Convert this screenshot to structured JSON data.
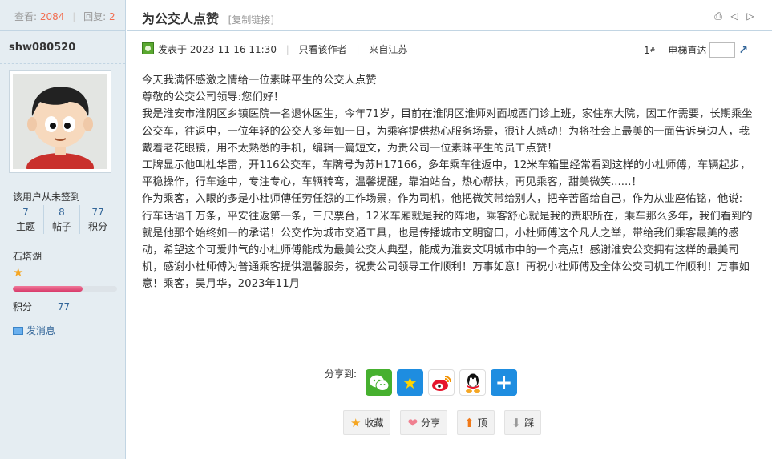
{
  "sidebar": {
    "views_label": "查看:",
    "views": "2084",
    "replies_label": "回复:",
    "replies": "2",
    "author": "shw080520",
    "signin_status": "该用户从未签到",
    "stats": [
      {
        "value": "7",
        "label": "主题"
      },
      {
        "value": "8",
        "label": "帖子"
      },
      {
        "value": "77",
        "label": "积分"
      }
    ],
    "group": "石塔湖",
    "credit_progress": 0.67,
    "score_label": "积分",
    "score_value": "77",
    "send_message": "发消息"
  },
  "thread": {
    "title": "为公交人点赞",
    "copy_link": "[复制链接]",
    "posted_at": "发表于 2023-11-16 11:30",
    "only_author": "只看该作者",
    "location": "来自江苏",
    "floor": "1",
    "floor_sup": "#",
    "elevator": "电梯直达",
    "paragraphs": [
      "今天我满怀感激之情给一位素昧平生的公交人点赞",
      "尊敬的公交公司领导:您们好！",
      "我是淮安市淮阴区乡镇医院一名退休医生，今年71岁，目前在淮阴区淮师对面城西门诊上班，家住东大院，因工作需要，长期乘坐公交车，往返中，一位年轻的公交人多年如一日，为乘客提供热心服务场景，很让人感动！为将社会上最美的一面告诉身边人，我戴着老花眼镜，用不太熟悉的手机，编辑一篇短文，为贵公司一位素昧平生的员工点赞！",
      "工牌显示他叫杜华雷，开116公交车，车牌号为苏H17166，多年乘车往返中，12米车箱里经常看到这样的小杜师傅，车辆起步，平稳操作，行车途中，专注专心，车辆转弯，温馨提醒，靠泊站台，热心帮扶，再见乘客，甜美微笑......！",
      "作为乘客，入眼的多是小杜师傅任劳任怨的工作场景，作为司机，他把微笑带给别人，把辛苦留给自己，作为从业座佑铭，他说:行车话语千万条，平安往返第一条，三尺票台，12米车厢就是我的阵地，乘客舒心就是我的责职所在，乘车那么多年，我们看到的就是他那个始终如一的承诺！公交作为城市交通工具，也是传播城市文明窗口，小杜师傅这个凡人之举，带给我们乘客最美的感动，希望这个可爱帅气的小杜师傅能成为最美公交人典型，能成为淮安文明城市中的一个亮点！感谢淮安公交拥有这样的最美司机，感谢小杜师傅为普通乘客提供温馨服务，祝贵公司领导工作顺利！万事如意！再祝小杜师傅及全体公交司机工作顺利！万事如意！乘客，吴月华，2023年11月"
    ],
    "share_label": "分享到:",
    "share_icons": [
      "wechat-icon",
      "qzone-icon",
      "weibo-icon",
      "qq-icon",
      "more-icon"
    ],
    "actions": {
      "favorite": "收藏",
      "share": "分享",
      "up": "顶",
      "down": "踩"
    }
  },
  "colors": {
    "sidebar_bg": "#e5edf2",
    "border": "#c2d5e3",
    "link": "#336699",
    "highlight": "#f26c4f"
  }
}
